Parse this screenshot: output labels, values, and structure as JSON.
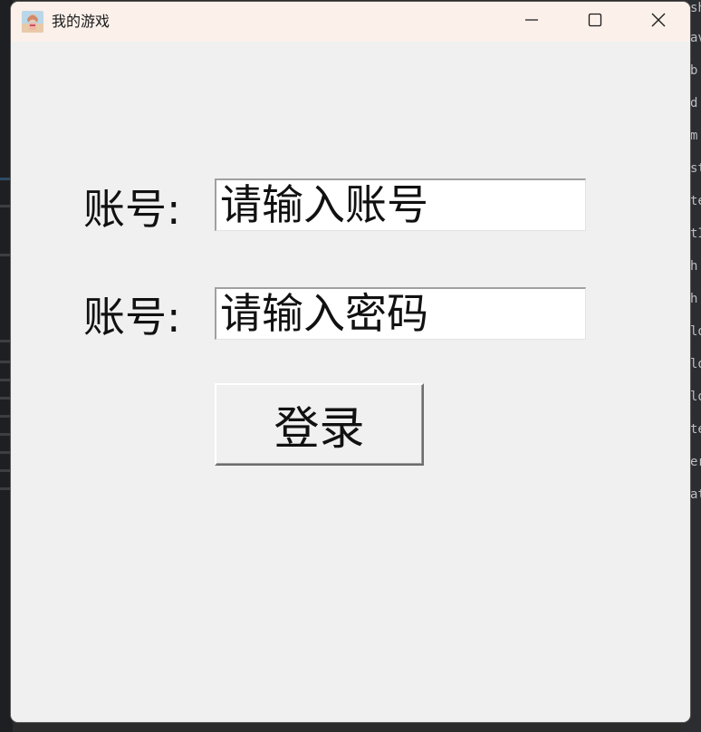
{
  "window": {
    "title": "我的游戏",
    "icon": "game-avatar-icon",
    "controls": {
      "minimize_icon": "minimize-icon",
      "maximize_icon": "maximize-icon",
      "close_icon": "close-icon"
    }
  },
  "form": {
    "account_label": "账号:",
    "account_value": "请输入账号",
    "password_label": "账号:",
    "password_value": "请输入密码",
    "login_label": "登录"
  },
  "background_right": {
    "lines": [
      "sh",
      "av",
      "b",
      "d",
      "m",
      "st",
      "te",
      "tI",
      "h",
      "h",
      "lo",
      "lo",
      "lo",
      "te",
      "er",
      "at"
    ]
  },
  "colors": {
    "titlebar": "#fbf0ea",
    "window_bg": "#f0f0f0",
    "input_bg": "#ffffff",
    "text": "#111111",
    "desktop_bg": "#2b2d30"
  }
}
